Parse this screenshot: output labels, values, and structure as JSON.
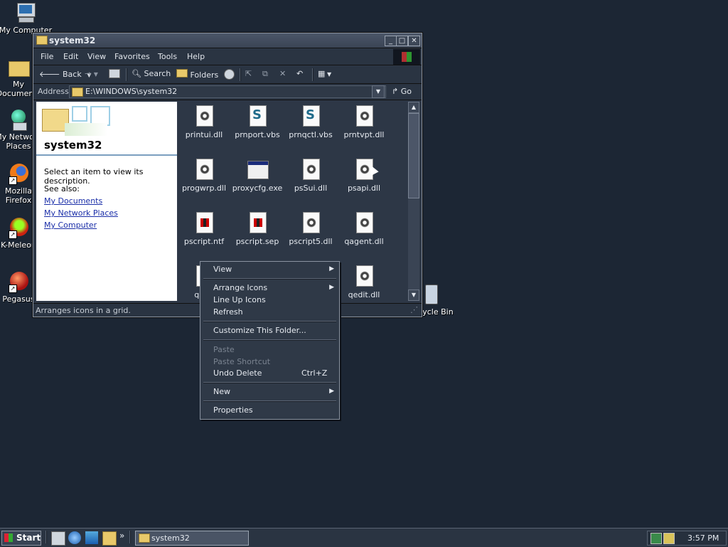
{
  "desktop": {
    "icons": [
      {
        "label": "My Computer"
      },
      {
        "label": "My Documents"
      },
      {
        "label": "My Network Places"
      },
      {
        "label": "Mozilla Firefox"
      },
      {
        "label": "K-Meleon"
      },
      {
        "label": "Pegasus"
      },
      {
        "label": "Recycle Bin"
      }
    ]
  },
  "window": {
    "title": "system32",
    "menu": [
      "File",
      "Edit",
      "View",
      "Favorites",
      "Tools",
      "Help"
    ],
    "toolbar": {
      "back": "Back",
      "search": "Search",
      "folders": "Folders"
    },
    "address": {
      "label": "Address",
      "value": "E:\\WINDOWS\\system32",
      "go": "Go"
    },
    "leftpanel": {
      "title": "system32",
      "description": "Select an item to view its description.",
      "see_also": "See also:",
      "links": [
        "My Documents",
        "My Network Places",
        "My Computer"
      ]
    },
    "files": [
      {
        "name": "printui.dll",
        "icon": "dll-icon"
      },
      {
        "name": "prnport.vbs",
        "icon": "script-icon"
      },
      {
        "name": "prnqctl.vbs",
        "icon": "script-icon"
      },
      {
        "name": "prntvpt.dll",
        "icon": "dll-icon"
      },
      {
        "name": "progwrp.dll",
        "icon": "dll-icon"
      },
      {
        "name": "proxycfg.exe",
        "icon": "exe-icon"
      },
      {
        "name": "psSui.dll",
        "icon": "dll-icon"
      },
      {
        "name": "psapi.dll",
        "icon": "dll-icon"
      },
      {
        "name": "pscript.ntf",
        "icon": "font-icon"
      },
      {
        "name": "pscript.sep",
        "icon": "font-icon"
      },
      {
        "name": "pscript5.dll",
        "icon": "dll-icon"
      },
      {
        "name": "qagent.dll",
        "icon": "dll-icon"
      },
      {
        "name": "qage",
        "icon": "dll-icon"
      },
      {
        "name": "qedit.dll",
        "icon": "dll-icon"
      }
    ],
    "status": "Arranges icons in a grid."
  },
  "context_menu": {
    "view": "View",
    "arrange_icons": "Arrange Icons",
    "line_up_icons": "Line Up Icons",
    "refresh": "Refresh",
    "customize": "Customize This Folder...",
    "paste": "Paste",
    "paste_shortcut": "Paste Shortcut",
    "undo_delete": "Undo Delete",
    "undo_shortcut": "Ctrl+Z",
    "new": "New",
    "properties": "Properties"
  },
  "taskbar": {
    "start": "Start",
    "task": "system32",
    "clock": "3:57 PM",
    "chevron": "»"
  }
}
